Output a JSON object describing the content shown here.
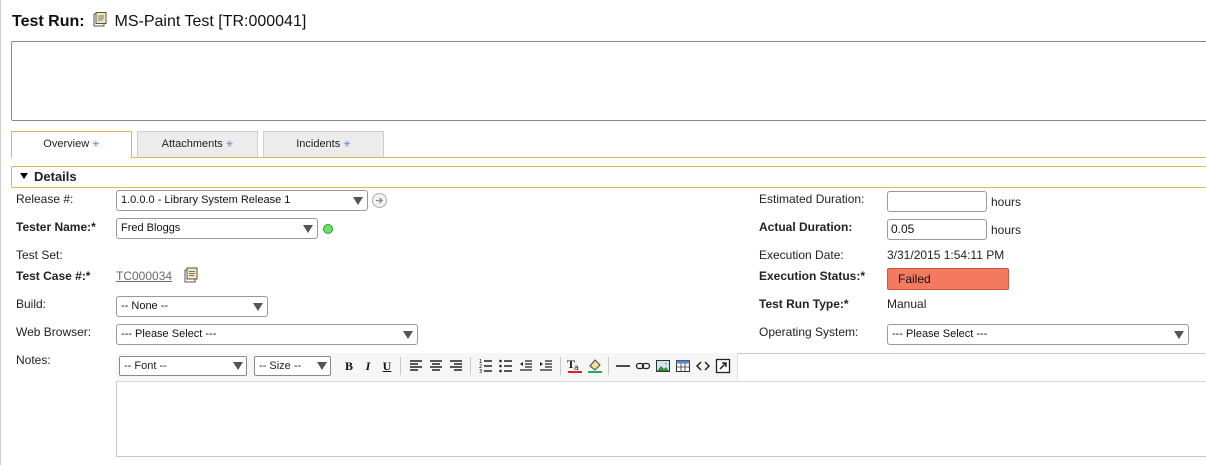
{
  "title": {
    "label": "Test Run:",
    "name": "MS-Paint Test [TR:000041]"
  },
  "tabs": [
    {
      "label": "Overview",
      "active": true
    },
    {
      "label": "Attachments",
      "active": false
    },
    {
      "label": "Incidents",
      "active": false
    }
  ],
  "tab_marker": "✳",
  "details": {
    "header": "Details"
  },
  "left_fields": {
    "release_label": "Release #:",
    "release_value": "1.0.0.0 - Library System Release 1",
    "tester_label": "Tester Name:*",
    "tester_value": "Fred Bloggs",
    "test_set_label": "Test Set:",
    "test_case_label": "Test Case #:*",
    "test_case_value": "TC000034",
    "build_label": "Build:",
    "build_value": "-- None --",
    "browser_label": "Web Browser:",
    "browser_value": "--- Please Select ---",
    "notes_label": "Notes:"
  },
  "right_fields": {
    "est_duration_label": "Estimated Duration:",
    "est_duration_value": "",
    "hours_unit": "hours",
    "actual_duration_label": "Actual Duration:",
    "actual_duration_value": "0.05",
    "exec_date_label": "Execution Date:",
    "exec_date_value": "3/31/2015 1:54:11 PM",
    "exec_status_label": "Execution Status:*",
    "exec_status_value": "Failed",
    "run_type_label": "Test Run Type:*",
    "run_type_value": "Manual",
    "os_label": "Operating System:",
    "os_value": "--- Please Select ---"
  },
  "editor": {
    "font_select": "-- Font --",
    "size_select": "-- Size --",
    "bold": "B",
    "italic": "I",
    "underline": "U"
  },
  "colors": {
    "accent": "#e0b84a",
    "status_failed": "#f47a5f",
    "link": "#6a6a6a"
  }
}
